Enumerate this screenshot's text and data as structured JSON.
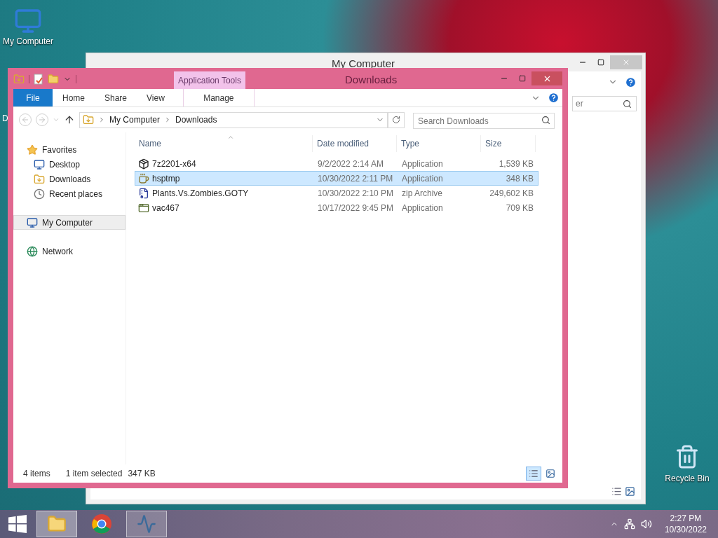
{
  "desktop_icons": [
    {
      "label": "My Computer",
      "kind": "computer"
    },
    {
      "label": "D",
      "kind": "partial"
    },
    {
      "label": "Recycle Bin",
      "kind": "bin"
    }
  ],
  "back_window": {
    "title": "My Computer",
    "search_text": "er"
  },
  "window": {
    "title": "Downloads",
    "contextual_group": "Application Tools",
    "ribbon_tabs": [
      {
        "label": "File",
        "kind": "file"
      },
      {
        "label": "Home",
        "kind": "tab"
      },
      {
        "label": "Share",
        "kind": "tab"
      },
      {
        "label": "View",
        "kind": "tab"
      },
      {
        "label": "Manage",
        "kind": "contextual"
      }
    ],
    "address": [
      "My Computer",
      "Downloads"
    ],
    "search": {
      "placeholder": "Search Downloads"
    },
    "nav": [
      {
        "label": "Favorites",
        "kind": "favorites",
        "selected": false,
        "children": [
          {
            "label": "Desktop",
            "kind": "desktop",
            "selected": false
          },
          {
            "label": "Downloads",
            "kind": "downloads",
            "selected": false
          },
          {
            "label": "Recent places",
            "kind": "recent",
            "selected": false
          }
        ]
      },
      {
        "label": "My Computer",
        "kind": "computer",
        "selected": true
      },
      {
        "label": "Network",
        "kind": "network",
        "selected": false
      }
    ],
    "columns": [
      "Name",
      "Date modified",
      "Type",
      "Size"
    ],
    "rows": [
      {
        "name": "7z2201-x64",
        "date": "9/2/2022 2:14 AM",
        "type": "Application",
        "size": "1,539 KB",
        "kind": "installer",
        "selected": false
      },
      {
        "name": "hsptmp",
        "date": "10/30/2022 2:11 PM",
        "type": "Application",
        "size": "348 KB",
        "kind": "cup",
        "selected": true
      },
      {
        "name": "Plants.Vs.Zombies.GOTY",
        "date": "10/30/2022 2:10 PM",
        "type": "zip Archive",
        "size": "249,602 KB",
        "kind": "zip",
        "selected": false
      },
      {
        "name": "vac467",
        "date": "10/17/2022 9:45 PM",
        "type": "Application",
        "size": "709 KB",
        "kind": "app",
        "selected": false
      }
    ],
    "status": [
      "4 items",
      "1 item selected",
      "347 KB"
    ],
    "views": [
      {
        "kind": "details",
        "selected": true
      },
      {
        "kind": "large",
        "selected": false
      }
    ]
  },
  "taskbar": {
    "items": [
      {
        "kind": "explorer",
        "selected": true,
        "running": true
      },
      {
        "kind": "chrome",
        "selected": false,
        "running": false
      },
      {
        "kind": "monitor",
        "selected": false,
        "running": true
      }
    ],
    "time": "2:27 PM",
    "date": "10/30/2022"
  }
}
